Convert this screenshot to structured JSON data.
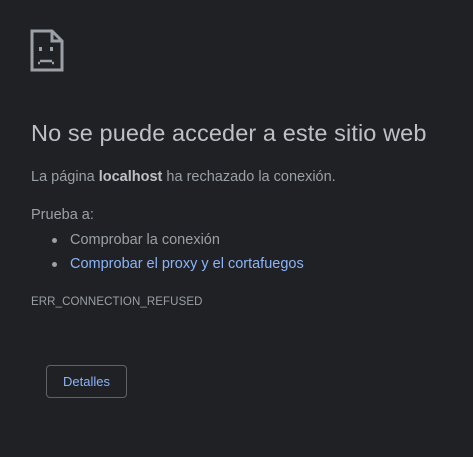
{
  "error_page": {
    "icon": "sad-page-icon",
    "title": "No se puede acceder a este sitio web",
    "description_prefix": "La página ",
    "host": "localhost",
    "description_suffix": " ha rechazado la conexión.",
    "try_label": "Prueba a:",
    "suggestions": [
      {
        "label": "Comprobar la conexión",
        "is_link": false
      },
      {
        "label": "Comprobar el proxy y el cortafuegos",
        "is_link": true
      }
    ],
    "error_code": "ERR_CONNECTION_REFUSED",
    "details_button": "Detalles"
  },
  "colors": {
    "background": "#202124",
    "title": "#bdc1c6",
    "body_text": "#9aa0a6",
    "link": "#8ab4f8",
    "button_border": "#5f6368"
  }
}
